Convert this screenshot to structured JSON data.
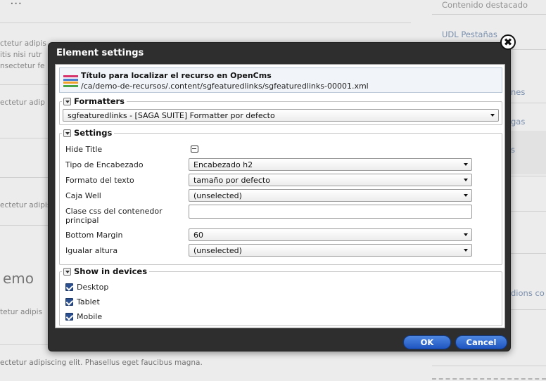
{
  "background": {
    "heading_top": "...",
    "lorem_lines": [
      "ctetur adipis",
      "itis nisi rutr",
      "nsectetur fe",
      "ectetur adip",
      "ectetur adipis",
      "tetur adipis",
      "ectetur adipiscing elit. Phasellus eget faucibus magna."
    ],
    "demo_heading": "emo",
    "sidebar": {
      "top_link": "Contenido destacado",
      "udl_link": "UDL Pestañas",
      "partial_links": [
        "nes",
        "gas",
        "s",
        "dions co"
      ]
    }
  },
  "dialog": {
    "title": "Element settings",
    "close_glyph": "✖",
    "resource": {
      "title": "Título para localizar el recurso en OpenCms",
      "path": "/ca/demo-de-recursos/.content/sgfeaturedlinks/sgfeaturedlinks-00001.xml",
      "icon_colors": [
        "#d6336c",
        "#4a7fd4",
        "#f0a12a",
        "#47a447"
      ]
    },
    "formatters": {
      "legend": "Formatters",
      "selected": "sgfeaturedlinks - [SAGA SUITE] Formatter por defecto"
    },
    "settings": {
      "legend": "Settings",
      "hide_title_label": "Hide Title",
      "tipo_encabezado_label": "Tipo de Encabezado",
      "tipo_encabezado_value": "Encabezado h2",
      "formato_texto_label": "Formato del texto",
      "formato_texto_value": "tamaño por defecto",
      "caja_well_label": "Caja Well",
      "caja_well_value": "(unselected)",
      "clase_css_label": "Clase css del contenedor principal",
      "clase_css_value": "",
      "bottom_margin_label": "Bottom Margin",
      "bottom_margin_value": "60",
      "igualar_altura_label": "Igualar altura",
      "igualar_altura_value": "(unselected)"
    },
    "devices": {
      "legend": "Show in devices",
      "items": [
        {
          "label": "Desktop",
          "checked": true
        },
        {
          "label": "Tablet",
          "checked": true
        },
        {
          "label": "Mobile",
          "checked": true
        }
      ]
    },
    "ok_label": "OK",
    "cancel_label": "Cancel"
  }
}
